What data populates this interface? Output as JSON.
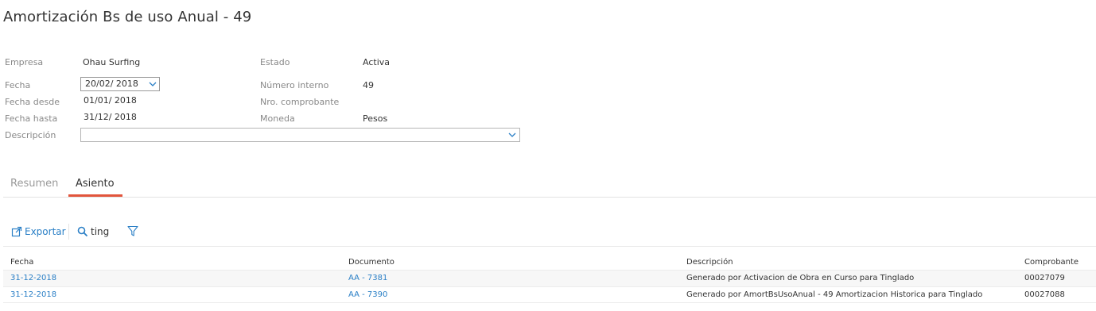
{
  "page": {
    "title": "Amortización Bs de uso Anual - 49"
  },
  "form": {
    "empresa_label": "Empresa",
    "empresa_value": "Ohau Surfing",
    "estado_label": "Estado",
    "estado_value": "Activa",
    "fecha_label": "Fecha",
    "fecha_value": "20/02/ 2018",
    "numero_interno_label": "Número interno",
    "numero_interno_value": "49",
    "fecha_desde_label": "Fecha desde",
    "fecha_desde_value": "01/01/ 2018",
    "nro_comprobante_label": "Nro. comprobante",
    "fecha_hasta_label": "Fecha hasta",
    "fecha_hasta_value": "31/12/ 2018",
    "moneda_label": "Moneda",
    "moneda_value": "Pesos",
    "descripcion_label": "Descripción",
    "descripcion_value": ""
  },
  "tabs": [
    {
      "label": "Resumen",
      "active": false
    },
    {
      "label": "Asiento",
      "active": true
    }
  ],
  "toolbar": {
    "export_label": "Exportar",
    "search_value": "ting"
  },
  "grid": {
    "columns": [
      "Fecha",
      "Documento",
      "Descripción",
      "Comprobante"
    ],
    "rows": [
      {
        "fecha": "31-12-2018",
        "documento": "AA - 7381",
        "descripcion": "Generado por Activacion de Obra en Curso para Tinglado",
        "comprobante": "00027079"
      },
      {
        "fecha": "31-12-2018",
        "documento": "AA - 7390",
        "descripcion": "Generado por AmortBsUsoAnual - 49 Amortizacion Historica para Tinglado",
        "comprobante": "00027088"
      }
    ]
  },
  "colors": {
    "accent_link": "#2a7fc6",
    "active_tab_underline": "#e2553c",
    "label_gray": "#888888"
  },
  "icons": [
    "chevron-down-icon",
    "export-icon",
    "search-icon",
    "filter-icon"
  ]
}
